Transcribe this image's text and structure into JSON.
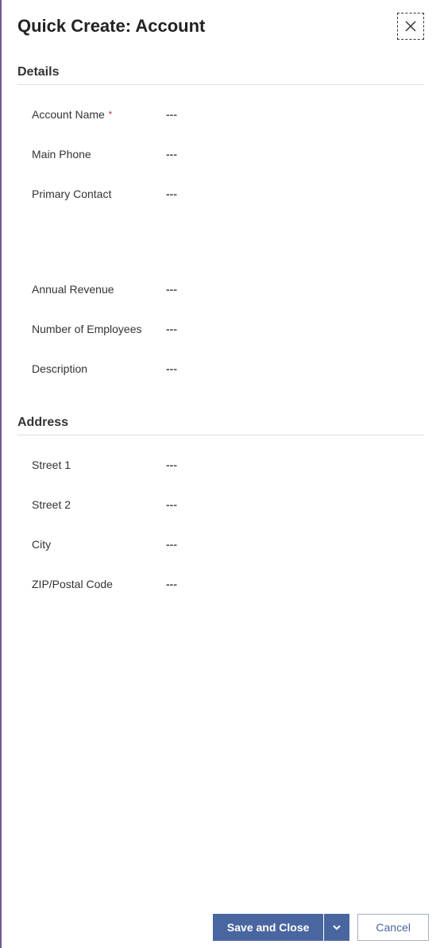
{
  "header": {
    "title": "Quick Create: Account"
  },
  "sections": {
    "details": {
      "title": "Details",
      "fields": {
        "account_name": {
          "label": "Account Name",
          "value": "---",
          "required": true
        },
        "main_phone": {
          "label": "Main Phone",
          "value": "---",
          "required": false
        },
        "primary_contact": {
          "label": "Primary Contact",
          "value": "---",
          "required": false
        },
        "annual_revenue": {
          "label": "Annual Revenue",
          "value": "---",
          "required": false
        },
        "num_employees": {
          "label": "Number of Employees",
          "value": "---",
          "required": false
        },
        "description": {
          "label": "Description",
          "value": "---",
          "required": false
        }
      }
    },
    "address": {
      "title": "Address",
      "fields": {
        "street1": {
          "label": "Street 1",
          "value": "---",
          "required": false
        },
        "street2": {
          "label": "Street 2",
          "value": "---",
          "required": false
        },
        "city": {
          "label": "City",
          "value": "---",
          "required": false
        },
        "zip": {
          "label": "ZIP/Postal Code",
          "value": "---",
          "required": false
        }
      }
    }
  },
  "footer": {
    "save_label": "Save and Close",
    "cancel_label": "Cancel"
  }
}
